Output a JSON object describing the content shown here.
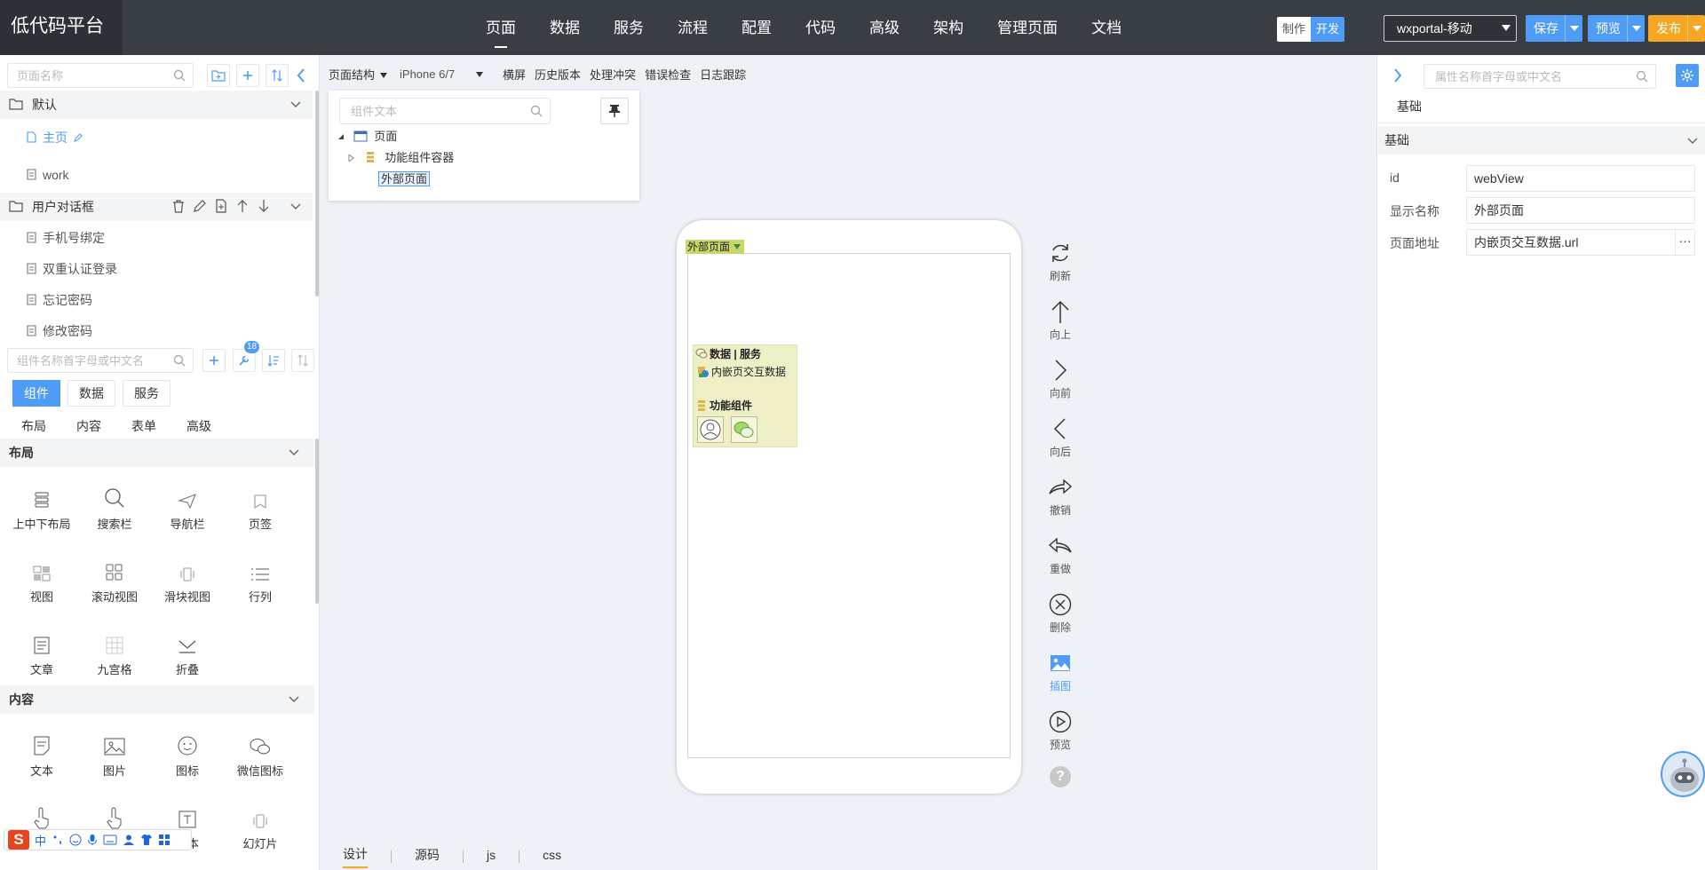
{
  "app": {
    "title": "低代码平台"
  },
  "topnav": {
    "items": [
      {
        "label": "页面",
        "active": true
      },
      {
        "label": "数据"
      },
      {
        "label": "服务"
      },
      {
        "label": "流程"
      },
      {
        "label": "配置"
      },
      {
        "label": "代码"
      },
      {
        "label": "高级"
      },
      {
        "label": "架构"
      },
      {
        "label": "管理页面"
      },
      {
        "label": "文档"
      }
    ],
    "mode_make": "制作",
    "mode_dev": "开发",
    "env": "wxportal-移动",
    "save": "保存",
    "preview": "预览",
    "publish": "发布"
  },
  "left": {
    "page_search_placeholder": "页面名称",
    "groups": [
      {
        "name": "默认",
        "pages": [
          {
            "label": "主页",
            "active": true
          },
          {
            "label": "work"
          }
        ]
      },
      {
        "name": "用户对话框",
        "pages": [
          {
            "label": "手机号绑定"
          },
          {
            "label": "双重认证登录"
          },
          {
            "label": "忘记密码"
          },
          {
            "label": "修改密码"
          }
        ]
      }
    ],
    "comp_search_placeholder": "组件名称首字母或中文名",
    "badge": "18",
    "tabs": [
      {
        "label": "组件",
        "active": true
      },
      {
        "label": "数据"
      },
      {
        "label": "服务"
      }
    ],
    "subtabs": [
      "布局",
      "内容",
      "表单",
      "高级"
    ],
    "sections": [
      {
        "title": "布局",
        "items": [
          {
            "label": "上中下布局",
            "icon": "layout-icon"
          },
          {
            "label": "搜索栏",
            "icon": "search-icon"
          },
          {
            "label": "导航栏",
            "icon": "nav-icon"
          },
          {
            "label": "页签",
            "icon": "tab-icon"
          },
          {
            "label": "视图",
            "icon": "view-icon"
          },
          {
            "label": "滚动视图",
            "icon": "scroll-view-icon"
          },
          {
            "label": "滑块视图",
            "icon": "slider-view-icon"
          },
          {
            "label": "行列",
            "icon": "rows-icon"
          },
          {
            "label": "文章",
            "icon": "article-icon"
          },
          {
            "label": "九宫格",
            "icon": "grid-icon"
          },
          {
            "label": "折叠",
            "icon": "collapse-icon"
          }
        ]
      },
      {
        "title": "内容",
        "items": [
          {
            "label": "文本",
            "icon": "text-icon"
          },
          {
            "label": "图片",
            "icon": "image-icon"
          },
          {
            "label": "图标",
            "icon": "emoji-icon"
          },
          {
            "label": "微信图标",
            "icon": "wechat-icon"
          },
          {
            "label": "",
            "icon": "touch-icon"
          },
          {
            "label": "",
            "icon": "touch-icon"
          },
          {
            "label": "文本",
            "icon": "text-block-icon"
          },
          {
            "label": "幻灯片",
            "icon": "slides-icon"
          }
        ]
      }
    ],
    "ime_lang": "中"
  },
  "canvas": {
    "toolbar": {
      "structure": "页面结构",
      "device": "iPhone 6/7",
      "landscape": "横屏",
      "history": "历史版本",
      "conflict": "处理冲突",
      "errors": "错误检查",
      "log": "日志跟踪"
    },
    "tree": {
      "search_placeholder": "组件文本",
      "root": "页面",
      "container": "功能组件容器",
      "selected": "外部页面"
    },
    "phone": {
      "webview_label": "外部页面",
      "data_service_title": "数据 | 服务",
      "data_item": "内嵌页交互数据",
      "func_title": "功能组件"
    },
    "sidetools": [
      {
        "label": "刷新",
        "icon": "refresh-icon"
      },
      {
        "label": "向上",
        "icon": "arrow-up-icon"
      },
      {
        "label": "向前",
        "icon": "chevron-right-icon"
      },
      {
        "label": "向后",
        "icon": "chevron-left-icon"
      },
      {
        "label": "撤销",
        "icon": "undo-icon"
      },
      {
        "label": "重做",
        "icon": "redo-icon"
      },
      {
        "label": "删除",
        "icon": "delete-icon"
      },
      {
        "label": "插图",
        "icon": "insert-image-icon",
        "active": true
      },
      {
        "label": "预览",
        "icon": "play-icon"
      }
    ],
    "help": "?",
    "bottom_tabs": [
      {
        "label": "设计",
        "active": true
      },
      {
        "label": "源码"
      },
      {
        "label": "js"
      },
      {
        "label": "css"
      }
    ]
  },
  "right": {
    "search_placeholder": "属性名称首字母或中文名",
    "tab": "基础",
    "section": "基础",
    "props": [
      {
        "label": "id",
        "value": "webView"
      },
      {
        "label": "显示名称",
        "value": "外部页面"
      },
      {
        "label": "页面地址",
        "value": "内嵌页交互数据.url",
        "more": "···"
      }
    ]
  },
  "colors": {
    "accent": "#4f9cf6",
    "publish": "#f5a623",
    "topbar": "#393d44"
  }
}
